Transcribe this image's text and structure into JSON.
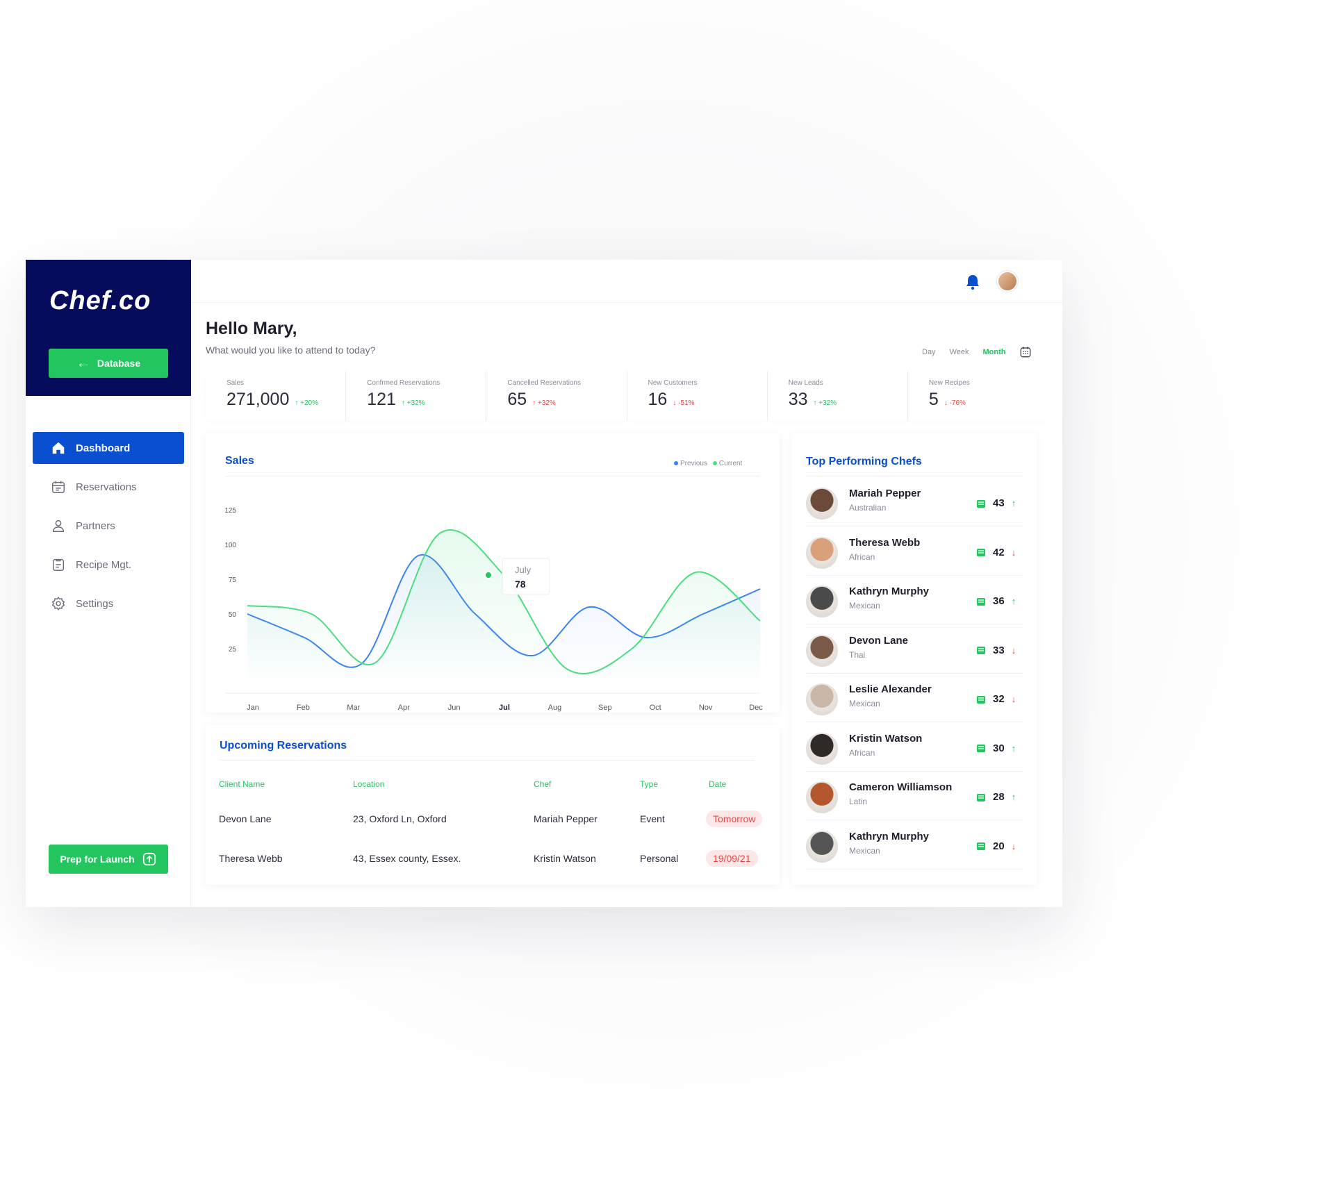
{
  "brand": {
    "logo": "Chef.co",
    "database_label": "Database"
  },
  "nav": [
    {
      "label": "Dashboard",
      "icon": "home-icon",
      "active": true
    },
    {
      "label": "Reservations",
      "icon": "calendar-icon",
      "active": false
    },
    {
      "label": "Partners",
      "icon": "user-icon",
      "active": false
    },
    {
      "label": "Recipe Mgt.",
      "icon": "clipboard-icon",
      "active": false
    },
    {
      "label": "Settings",
      "icon": "gear-icon",
      "active": false
    }
  ],
  "launch_label": "Prep for Launch",
  "header": {
    "greeting": "Hello Mary,",
    "subtitle": "What would you like to attend to today?"
  },
  "period": {
    "day": "Day",
    "week": "Week",
    "month": "Month",
    "active": "Month"
  },
  "stats": [
    {
      "label": "Sales",
      "value": "271,000",
      "delta": "+20%",
      "dir": "up"
    },
    {
      "label": "Confrmed Reservations",
      "value": "121",
      "delta": "+32%",
      "dir": "up"
    },
    {
      "label": "Cancelled Reservations",
      "value": "65",
      "delta": "+32%",
      "dir": "down"
    },
    {
      "label": "New Customers",
      "value": "16",
      "delta": "-51%",
      "dir": "down"
    },
    {
      "label": "New Leads",
      "value": "33",
      "delta": "+32%",
      "dir": "up"
    },
    {
      "label": "New Recipes",
      "value": "5",
      "delta": "-76%",
      "dir": "down"
    }
  ],
  "sales": {
    "title": "Sales",
    "legend_previous": "Previous",
    "legend_current": "Current",
    "tooltip_month": "July",
    "tooltip_value": "78"
  },
  "chart_data": {
    "type": "line",
    "title": "Sales",
    "categories": [
      "Jan",
      "Feb",
      "Mar",
      "Apr",
      "Jun",
      "Jul",
      "Aug",
      "Sep",
      "Oct",
      "Nov",
      "Dec"
    ],
    "yticks": [
      25,
      50,
      75,
      100,
      125
    ],
    "ylim": [
      0,
      135
    ],
    "series": [
      {
        "name": "Previous",
        "color": "#3b82f6",
        "values": [
          50,
          33,
          14,
          92,
          50,
          20,
          55,
          33,
          50,
          68
        ]
      },
      {
        "name": "Current",
        "color": "#4ade80",
        "values": [
          56,
          50,
          15,
          108,
          78,
          10,
          25,
          80,
          45
        ]
      }
    ]
  },
  "reservations": {
    "title": "Upcoming Reservations",
    "headers": [
      "Client Name",
      "Location",
      "Chef",
      "Type",
      "Date"
    ],
    "rows": [
      {
        "client": "Devon Lane",
        "location": "23, Oxford Ln, Oxford",
        "chef": "Mariah Pepper",
        "type": "Event",
        "date": "Tomorrow"
      },
      {
        "client": "Theresa Webb",
        "location": "43, Essex county, Essex.",
        "chef": "Kristin Watson",
        "type": "Personal",
        "date": "19/09/21"
      }
    ]
  },
  "chefs": {
    "title": "Top Performing Chefs",
    "list": [
      {
        "name": "Mariah Pepper",
        "cuisine": "Australian",
        "score": "43",
        "dir": "up",
        "tone": "#6b4a3a"
      },
      {
        "name": "Theresa Webb",
        "cuisine": "African",
        "score": "42",
        "dir": "down",
        "tone": "#d9a07a"
      },
      {
        "name": "Kathryn Murphy",
        "cuisine": "Mexican",
        "score": "36",
        "dir": "up",
        "tone": "#4a4a4a"
      },
      {
        "name": "Devon Lane",
        "cuisine": "Thai",
        "score": "33",
        "dir": "down",
        "tone": "#7a5a48"
      },
      {
        "name": "Leslie Alexander",
        "cuisine": "Mexican",
        "score": "32",
        "dir": "down",
        "tone": "#c9b8a8"
      },
      {
        "name": "Kristin Watson",
        "cuisine": "African",
        "score": "30",
        "dir": "up",
        "tone": "#2f2a28"
      },
      {
        "name": "Cameron Williamson",
        "cuisine": "Latin",
        "score": "28",
        "dir": "up",
        "tone": "#b5572e"
      },
      {
        "name": "Kathryn Murphy",
        "cuisine": "Mexican",
        "score": "20",
        "dir": "down",
        "tone": "#555555"
      }
    ]
  },
  "colors": {
    "brand_navy": "#070b5c",
    "primary_blue": "#0a4fd0",
    "green": "#22c55e",
    "red": "#ef4444"
  }
}
